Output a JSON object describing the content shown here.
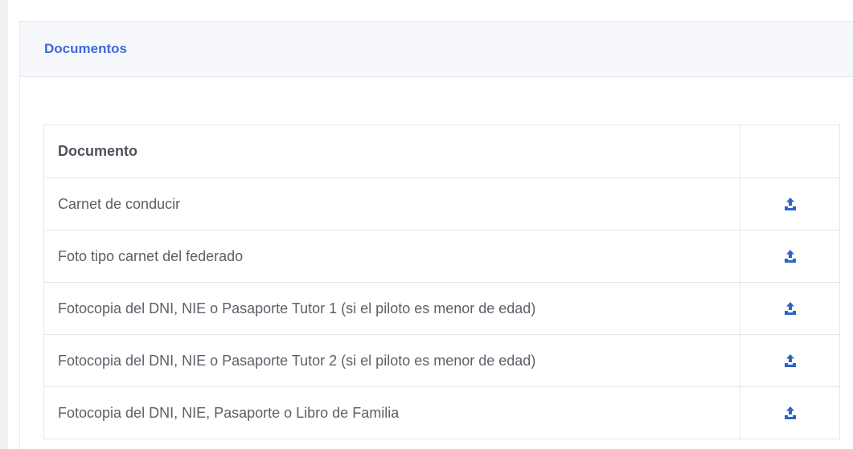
{
  "card": {
    "title": "Documentos"
  },
  "table": {
    "headers": [
      "Documento",
      ""
    ],
    "rows": [
      {
        "label": "Carnet de conducir",
        "action_icon": "upload-icon"
      },
      {
        "label": "Foto tipo carnet del federado",
        "action_icon": "upload-icon"
      },
      {
        "label": "Fotocopia del DNI, NIE o Pasaporte Tutor 1 (si el piloto es menor de edad)",
        "action_icon": "upload-icon"
      },
      {
        "label": "Fotocopia del DNI, NIE o Pasaporte Tutor 2 (si el piloto es menor de edad)",
        "action_icon": "upload-icon"
      },
      {
        "label": "Fotocopia del DNI, NIE, Pasaporte o Libro de Familia",
        "action_icon": "upload-icon"
      }
    ]
  },
  "colors": {
    "accent": "#3f69d8",
    "icon": "#2f63c9"
  }
}
